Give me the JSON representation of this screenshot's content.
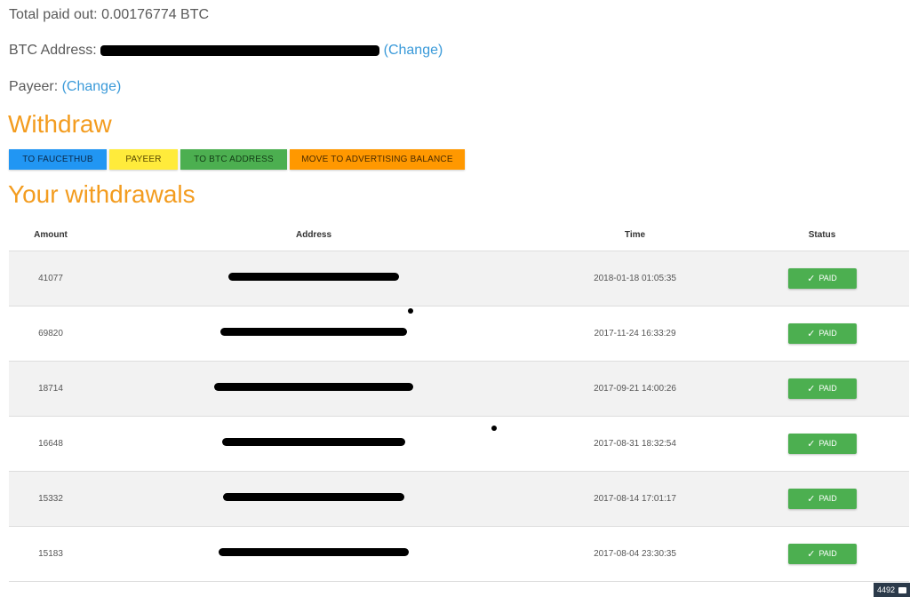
{
  "account": {
    "total_paid_label": "Total paid out:",
    "total_paid_value": "0.00176774 BTC",
    "btc_address_label": "BTC Address:",
    "payeer_label": "Payeer:",
    "change_link": "(Change)"
  },
  "withdraw": {
    "heading": "Withdraw",
    "buttons": [
      "TO FAUCETHUB",
      "PAYEER",
      "TO BTC ADDRESS",
      "MOVE TO ADVERTISING BALANCE"
    ],
    "colors": {
      "faucethub": "#2196f3",
      "payeer": "#ffeb3b",
      "btc": "#4caf50",
      "advertising": "#ff9800"
    }
  },
  "withdrawals": {
    "heading": "Your withdrawals",
    "columns": [
      "Amount",
      "Address",
      "Time",
      "Status"
    ],
    "rows": [
      {
        "amount": "41077",
        "time": "2018-01-18 01:05:35",
        "status": "PAID"
      },
      {
        "amount": "69820",
        "time": "2017-11-24 16:33:29",
        "status": "PAID"
      },
      {
        "amount": "18714",
        "time": "2017-09-21 14:00:26",
        "status": "PAID"
      },
      {
        "amount": "16648",
        "time": "2017-08-31 18:32:54",
        "status": "PAID"
      },
      {
        "amount": "15332",
        "time": "2017-08-14 17:01:17",
        "status": "PAID"
      },
      {
        "amount": "15183",
        "time": "2017-08-04 23:30:35",
        "status": "PAID"
      }
    ]
  },
  "corner_badge": {
    "count": "4492",
    "icon": "chat-icon"
  },
  "theme": {
    "heading_color": "#f39c1f",
    "link_color": "#3a9ad9",
    "paid_color": "#4caf50"
  }
}
